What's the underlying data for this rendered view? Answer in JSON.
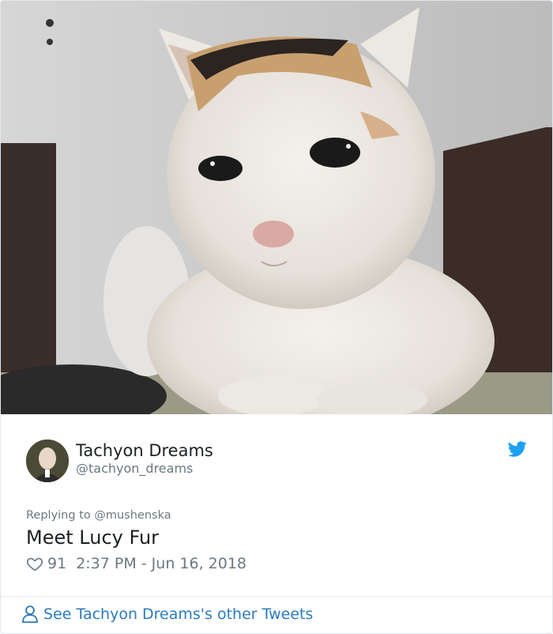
{
  "media": {
    "icon": "cat-photo"
  },
  "author": {
    "name": "Tachyon Dreams",
    "handle": "@tachyon_dreams",
    "avatar_icon": "profile-photo"
  },
  "reply": {
    "prefix": "Replying to",
    "to": "@mushenska"
  },
  "tweet": {
    "text": "Meet Lucy Fur",
    "likes": "91",
    "timestamp": "2:37 PM - Jun 16, 2018"
  },
  "footer": {
    "link_label": "See Tachyon Dreams's other Tweets"
  },
  "colors": {
    "twitter_blue": "#1da1f2",
    "link_blue": "#2b7bb9",
    "muted_gray": "#697882",
    "text_dark": "#1c2022"
  }
}
